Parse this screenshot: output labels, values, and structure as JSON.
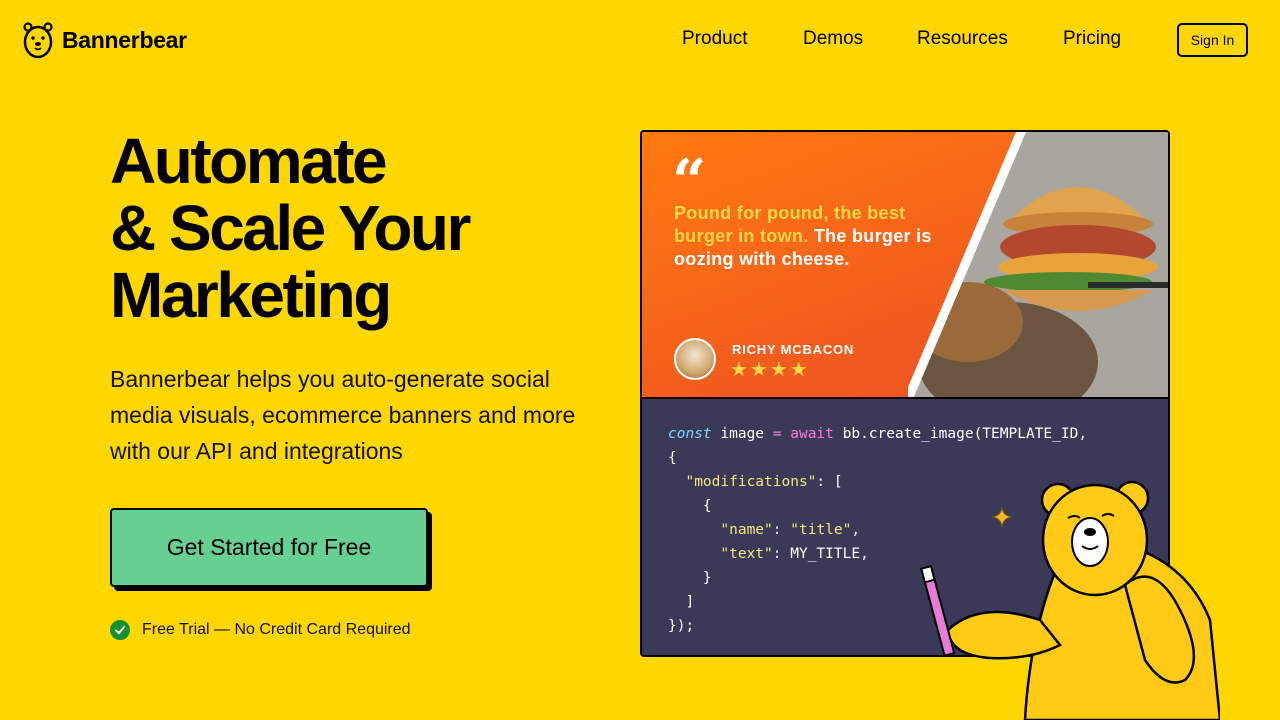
{
  "header": {
    "logo_text": "Bannerbear",
    "nav": [
      "Product",
      "Demos",
      "Resources",
      "Pricing"
    ],
    "signin_label": "Sign In"
  },
  "hero": {
    "headline": [
      "Automate",
      "& Scale Your",
      "Marketing"
    ],
    "subtext": "Bannerbear helps you auto-generate social media visuals, ecommerce banners and more with our API and integrations",
    "cta_label": "Get Started for Free",
    "trial_text": "Free Trial — No Credit Card Required"
  },
  "demo": {
    "quote_mark": "“",
    "quote_yellow": "Pound for pound, the best burger in town.",
    "quote_white": "The burger is oozing with cheese.",
    "author_name": "RICHY MCBACON",
    "rating_stars": "★★★★",
    "code_lines": [
      {
        "parts": [
          {
            "t": "const",
            "c": "k-const"
          },
          {
            "t": " image "
          },
          {
            "t": "=",
            "c": "k-op"
          },
          {
            "t": " "
          },
          {
            "t": "await",
            "c": "k-await"
          },
          {
            "t": " bb.create_image(TEMPLATE_ID,"
          }
        ]
      },
      {
        "parts": [
          {
            "t": "{"
          }
        ]
      },
      {
        "parts": [
          {
            "t": "  "
          },
          {
            "t": "\"modifications\"",
            "c": "k-str"
          },
          {
            "t": ": ["
          }
        ]
      },
      {
        "parts": [
          {
            "t": "    {"
          }
        ]
      },
      {
        "parts": [
          {
            "t": "      "
          },
          {
            "t": "\"name\"",
            "c": "k-str"
          },
          {
            "t": ": "
          },
          {
            "t": "\"title\"",
            "c": "k-str"
          },
          {
            "t": ","
          }
        ]
      },
      {
        "parts": [
          {
            "t": "      "
          },
          {
            "t": "\"text\"",
            "c": "k-str"
          },
          {
            "t": ": MY_TITLE,"
          }
        ]
      },
      {
        "parts": [
          {
            "t": "    }"
          }
        ]
      },
      {
        "parts": [
          {
            "t": "  ]"
          }
        ]
      },
      {
        "parts": [
          {
            "t": "});"
          }
        ]
      }
    ]
  },
  "colors": {
    "background": "#FFD700",
    "cta": "#66CF92",
    "code_bg": "#3a3a58",
    "check": "#17902f"
  }
}
